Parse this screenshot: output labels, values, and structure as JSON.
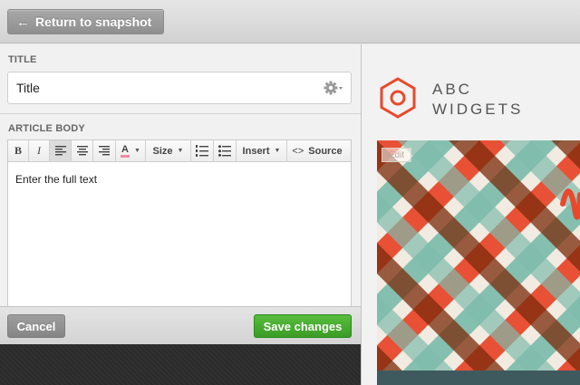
{
  "topbar": {
    "return_label": "Return to snapshot",
    "return_icon": "arrow-left-icon"
  },
  "form": {
    "title_label": "TITLE",
    "title_value": "Title",
    "settings_icon": "gear-icon",
    "body_label": "ARTICLE BODY",
    "toolbar": {
      "bold": "B",
      "italic": "I",
      "text_color": "A",
      "size": "Size",
      "insert": "Insert",
      "source": "Source",
      "source_icon": "code-icon"
    },
    "body_text": "Enter the full text"
  },
  "footer": {
    "cancel_label": "Cancel",
    "save_label": "Save changes"
  },
  "preview": {
    "brand_line1": "ABC",
    "brand_line2": "WIDGETS",
    "edit_label": "Edit",
    "colors": {
      "accent": "#e8492c",
      "teal": "#7fbcad",
      "brown": "#7b2a0b",
      "cream": "#f1ebe1",
      "save_green": "#3fa32a"
    }
  }
}
